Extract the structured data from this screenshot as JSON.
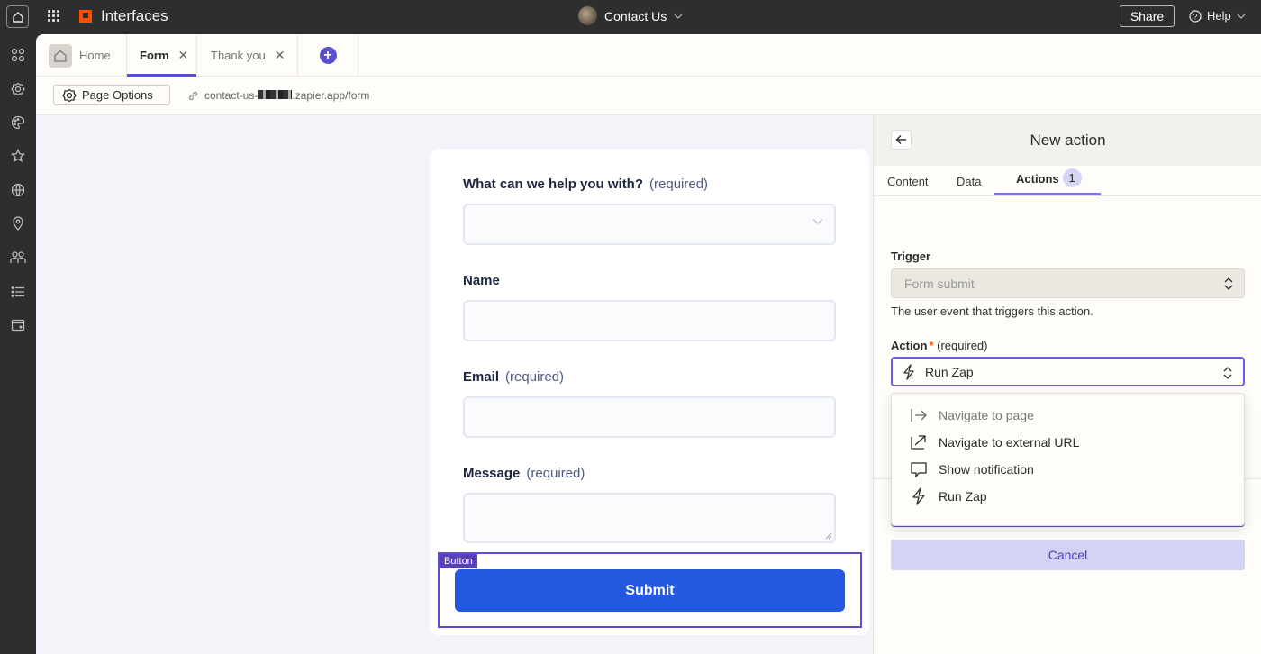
{
  "topbar": {
    "app_title": "Interfaces",
    "page_name": "Contact Us",
    "share_label": "Share",
    "help_label": "Help"
  },
  "leftbar": {
    "icons": [
      "apps-icon",
      "settings-icon",
      "palette-icon",
      "star-icon",
      "globe-icon",
      "location-icon",
      "users-icon",
      "list-icon",
      "wallet-icon"
    ]
  },
  "tabs": [
    {
      "label": "Home"
    },
    {
      "label": "Form",
      "active": true
    },
    {
      "label": "Thank you"
    }
  ],
  "subbar": {
    "page_options_label": "Page Options",
    "url_prefix": "contact-us-",
    "url_suffix": ".zapier.app/form"
  },
  "form": {
    "fields": [
      {
        "label": "What can we help you with?",
        "required_text": "(required)",
        "type": "select",
        "value": ""
      },
      {
        "label": "Name",
        "required_text": "",
        "type": "text",
        "value": ""
      },
      {
        "label": "Email",
        "required_text": "(required)",
        "type": "text",
        "value": ""
      },
      {
        "label": "Message",
        "required_text": "(required)",
        "type": "textarea",
        "value": ""
      }
    ],
    "button_tag": "Button",
    "submit_label": "Submit"
  },
  "panel": {
    "title": "New action",
    "tabs": [
      {
        "label": "Content"
      },
      {
        "label": "Data"
      },
      {
        "label": "Actions",
        "badge": "1",
        "active": true
      }
    ],
    "trigger_label": "Trigger",
    "trigger_value": "Form submit",
    "trigger_help": "The user event that triggers this action.",
    "action_label": "Action",
    "action_star": "*",
    "action_required": "(required)",
    "action_value": "Run Zap",
    "options": [
      {
        "label": "Navigate to page",
        "icon": "arrow-to-line-icon"
      },
      {
        "label": "Navigate to external URL",
        "icon": "external-link-icon"
      },
      {
        "label": "Show notification",
        "icon": "message-icon"
      },
      {
        "label": "Run Zap",
        "icon": "bolt-icon"
      }
    ],
    "cancel_label": "Cancel"
  },
  "colors": {
    "accent": "#5a4fcf",
    "brand": "#ff4f00",
    "submit": "#2458e0"
  }
}
